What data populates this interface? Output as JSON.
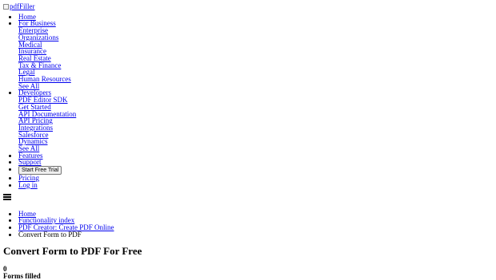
{
  "header": {
    "logo_alt": "pdfFiller"
  },
  "nav": {
    "home": "Home",
    "for_business": {
      "label": "For Business",
      "items": [
        "Enterprise",
        "Organizations",
        "Medical",
        "Insurance",
        "Real Estate",
        "Tax & Finance",
        "Legal",
        "Human Resources",
        "See All"
      ]
    },
    "developers": {
      "label": "Developers",
      "items": [
        "PDF Editor SDK",
        "Get Started",
        "API Documentation",
        "API Pricing",
        "Integrations",
        "Salesforce",
        "Dynamics",
        "See All"
      ]
    },
    "features": "Features",
    "support": "Support",
    "start_trial": "Start Free Trial",
    "pricing": "Pricing",
    "login": "Log in"
  },
  "breadcrumb": {
    "items": [
      "Home",
      "Functionality index",
      "PDF Creator: Create PDF Online"
    ],
    "current": "Convert Form to PDF"
  },
  "page": {
    "title": "Convert Form to PDF For Free",
    "counter_value": "0",
    "counter_label": "Forms filled"
  }
}
